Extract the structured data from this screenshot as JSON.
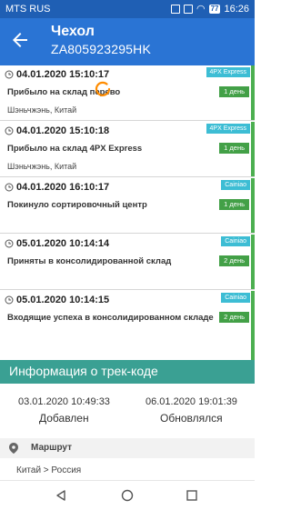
{
  "status_bar": {
    "carrier": "MTS RUS",
    "battery": "77",
    "time": "16:26"
  },
  "appbar": {
    "title": "Чехол",
    "tracking_number": "ZA805923295HK"
  },
  "spinner_color": "#ff8c00",
  "events": [
    {
      "date": "04.01.2020 15:10:17",
      "status": "Прибыло на склад перево",
      "location": "Шэньчжэнь, Китай",
      "carrier": "4PX Express",
      "days": "1 день"
    },
    {
      "date": "04.01.2020 15:10:18",
      "status": "Прибыло на склад 4PX Express",
      "location": "Шэньчжэнь, Китай",
      "carrier": "4PX Express",
      "days": "1 день"
    },
    {
      "date": "04.01.2020 16:10:17",
      "status": "Покинуло сортировочный центр",
      "location": "",
      "carrier": "Cainiao",
      "days": "1 день"
    },
    {
      "date": "05.01.2020 10:14:14",
      "status": "Приняты в консолидированной склад",
      "location": "",
      "carrier": "Cainiao",
      "days": "2 день"
    },
    {
      "date": "05.01.2020 10:14:15",
      "status": "Входящие успеха в консолидированном складе",
      "location": "",
      "carrier": "Cainiao",
      "days": "2 день"
    }
  ],
  "info": {
    "header": "Информация о трек-коде",
    "added_date": "03.01.2020 10:49:33",
    "added_label": "Добавлен",
    "updated_date": "06.01.2020 19:01:39",
    "updated_label": "Обновлялся",
    "route_label": "Маршрут",
    "route_value": "Китай > Россия"
  },
  "colors": {
    "status_bar": "#1f5fb4",
    "appbar": "#2a74d4",
    "info_header": "#3aa093",
    "carrier_badge": "#3dbdd4",
    "days_badge": "#43a047"
  },
  "icons": [
    "back-arrow-icon",
    "clock-icon",
    "location-pin-icon",
    "nav-back-icon",
    "nav-home-icon",
    "nav-recent-icon"
  ]
}
